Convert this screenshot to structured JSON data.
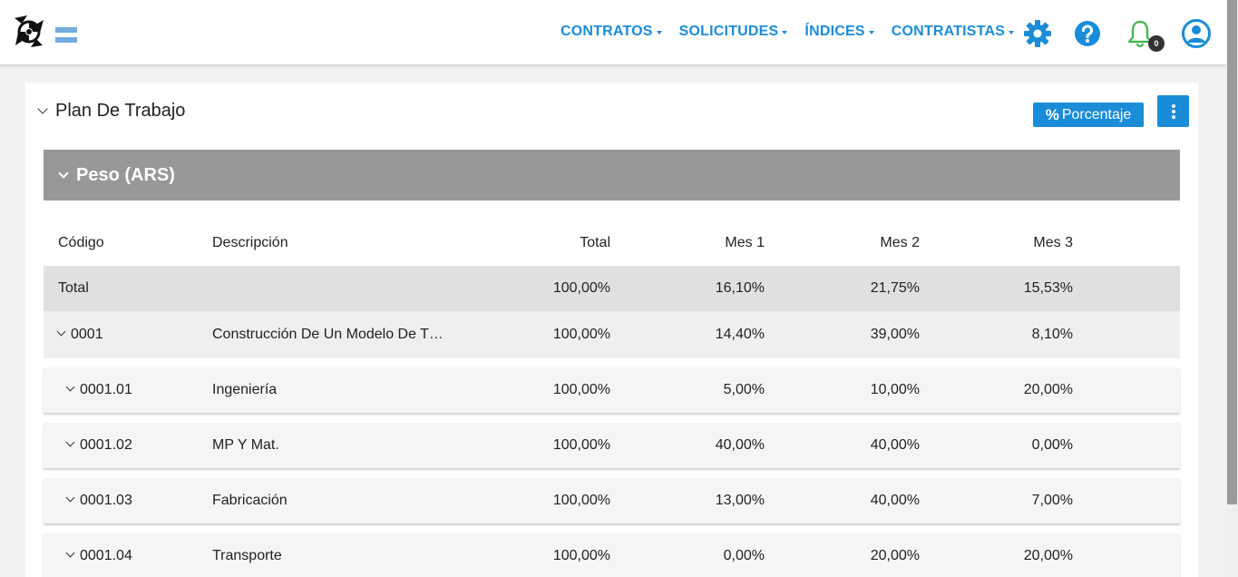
{
  "nav": {
    "items": [
      {
        "label": "CONTRATOS"
      },
      {
        "label": "SOLICITUDES"
      },
      {
        "label": "ÍNDICES"
      },
      {
        "label": "CONTRATISTAS"
      }
    ],
    "notifications_count": "0",
    "accent_color": "#1a8cd8",
    "bell_color": "#3cb44b",
    "icons": [
      "gear-icon",
      "help-icon",
      "bell-icon",
      "user-icon"
    ]
  },
  "card": {
    "title": "Plan De Trabajo",
    "percent_button": "Porcentaje",
    "section_title": "Peso (ARS)"
  },
  "table": {
    "headers": {
      "code": "Código",
      "description": "Descripción",
      "total": "Total",
      "m1": "Mes 1",
      "m2": "Mes 2",
      "m3": "Mes 3"
    },
    "rows": [
      {
        "code": "Total",
        "description": "",
        "total": "100,00%",
        "m1": "16,10%",
        "m2": "21,75%",
        "m3": "15,53%"
      },
      {
        "code": "0001",
        "description": "Construcción De Un Modelo De T…",
        "total": "100,00%",
        "m1": "14,40%",
        "m2": "39,00%",
        "m3": "8,10%"
      },
      {
        "code": "0001.01",
        "description": "Ingeniería",
        "total": "100,00%",
        "m1": "5,00%",
        "m2": "10,00%",
        "m3": "20,00%"
      },
      {
        "code": "0001.02",
        "description": "MP Y Mat.",
        "total": "100,00%",
        "m1": "40,00%",
        "m2": "40,00%",
        "m3": "0,00%"
      },
      {
        "code": "0001.03",
        "description": "Fabricación",
        "total": "100,00%",
        "m1": "13,00%",
        "m2": "40,00%",
        "m3": "7,00%"
      },
      {
        "code": "0001.04",
        "description": "Transporte",
        "total": "100,00%",
        "m1": "0,00%",
        "m2": "20,00%",
        "m3": "20,00%"
      }
    ]
  }
}
